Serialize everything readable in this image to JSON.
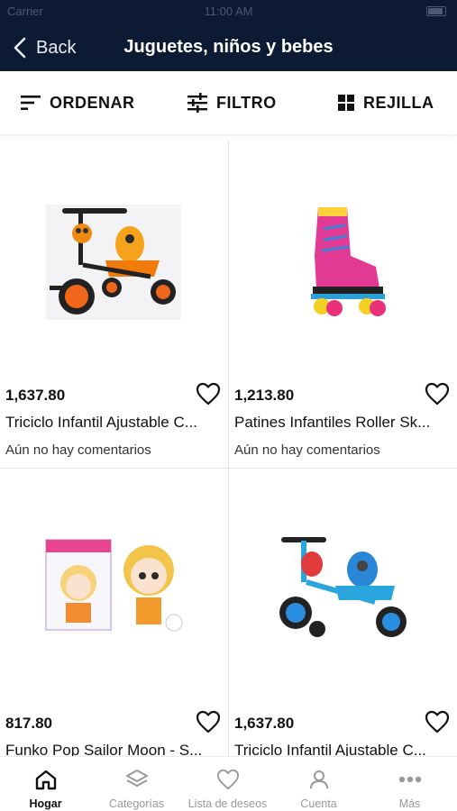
{
  "status_bar": {
    "carrier": "Carrier",
    "time": "11:00 AM"
  },
  "header": {
    "back_label": "Back",
    "title": "Juguetes, niños y bebes",
    "background": "#0c1b33"
  },
  "toolbar": {
    "sort_label": "ORDENAR",
    "filter_label": "FILTRO",
    "grid_label": "REJILLA"
  },
  "products": [
    {
      "price": "1,637.80",
      "name": "Triciclo Infantil Ajustable C...",
      "reviews": "Aún no hay comentarios",
      "image": "orange-tricycle"
    },
    {
      "price": "1,213.80",
      "name": "Patines Infantiles Roller Sk...",
      "reviews": "Aún no hay comentarios",
      "image": "pink-roller-skate"
    },
    {
      "price": "817.80",
      "name": "Funko Pop Sailor Moon - S...",
      "image": "funko-pop"
    },
    {
      "price": "1,637.80",
      "name": "Triciclo Infantil Ajustable C...",
      "image": "blue-tricycle"
    }
  ],
  "tabbar": {
    "items": [
      {
        "label": "Hogar",
        "icon": "home-icon",
        "active": true
      },
      {
        "label": "Categorías",
        "icon": "layers-icon"
      },
      {
        "label": "Lista de deseos",
        "icon": "heart-icon"
      },
      {
        "label": "Cuenta",
        "icon": "user-icon"
      },
      {
        "label": "Más",
        "icon": "more-icon"
      }
    ]
  }
}
